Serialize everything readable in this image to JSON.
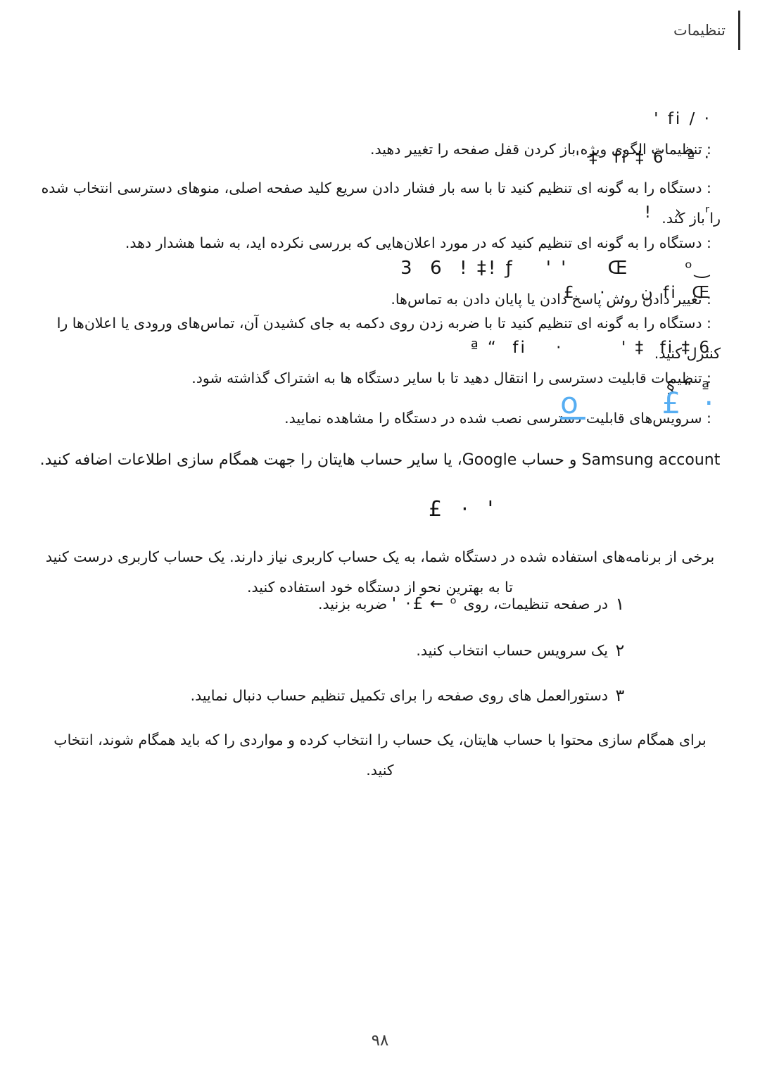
{
  "document": {
    "language": "fa",
    "direction": "rtl",
    "header_title": "تنظیمات",
    "page_number": "۹۸",
    "accent_color": "#57AEF2",
    "text_color": "#151515"
  },
  "accessibility_options": [
    {
      "id": "direct-access",
      "glyphs": "' fi / ·",
      "text": ": تنظیمات الگوی ویژه باز کردن قفل صفحه را تغییر دهید."
    },
    {
      "id": "direct-access-shortcut",
      "glyphs": "' ‡  fi ‡ 6   ª ·",
      "text": ": دستگاه را به گونه ای تنظیم کنید تا با سه بار فشار دادن سریع کلید صفحه اصلی، منوهای دسترسی انتخاب شده را باز کند."
    },
    {
      "id": "notification-reminder",
      "glyphs": "!   ›   ʳ",
      "text": ": دستگاه را به گونه ای تنظیم کنید که در مورد اعلان‌هایی که بررسی نکرده اید، به شما هشدار دهد."
    },
    {
      "id": "answering-ending-calls",
      "glyphs": "3  6  ! ‡! ƒ    ' '     Œ       ᵒ‿",
      "text": ": تغییر دادن روش پاسخ دادن یا پایان دادن به تماس‌ها."
    },
    {
      "id": "single-tap-mode",
      "glyphs": "£     ·   .   ن  fi  Œ",
      "text": ": دستگاه را به گونه ای تنظیم کنید تا با ضربه زدن روی دکمه به جای کشیدن آن، تماس‌های ورودی یا اعلان‌ها را کنترل کنید."
    },
    {
      "id": "manage-accessibility",
      "glyphs": "ª “  fi    ·        ' ‡  fi ‡ 6",
      "text": ": تنظیمات قابلیت دسترسی را انتقال دهید تا با سایر دستگاه ها به اشتراک گذاشته شود."
    },
    {
      "id": "accessibility-services",
      "glyphs": "§ “ ª",
      "text": ": سرویس‌های قابلیت دسترسی نصب شده در دستگاه را مشاهده نمایید."
    }
  ],
  "accounts_section": {
    "heading_glyphs_right": "£ ·",
    "heading_glyphs_left": "o",
    "intro": "Samsung account و حساب Google، یا سایر حساب هایتان را جهت همگام سازی اطلاعات اضافه کنید.",
    "subheading_glyphs": "£ ·     '",
    "description": "برخی از برنامه‌های استفاده شده در دستگاه شما، به یک حساب کاربری نیاز دارند. یک حساب کاربری درست کنید تا به بهترین نحو از دستگاه خود استفاده کنید.",
    "steps": [
      {
        "number": "۱",
        "text_before": "در صفحه تنظیمات، روی",
        "glyphs_a": "ᵒ",
        "arrow": "←",
        "glyphs_b": "'   ·£",
        "text_after": "ضربه بزنید."
      },
      {
        "number": "۲",
        "text_before": "یک سرویس حساب انتخاب کنید.",
        "glyphs_a": "",
        "arrow": "",
        "glyphs_b": "",
        "text_after": ""
      },
      {
        "number": "۳",
        "text_before": "دستورالعمل های روی صفحه را برای تکمیل تنظیم حساب دنبال نمایید.",
        "glyphs_a": "",
        "arrow": "",
        "glyphs_b": "",
        "text_after": ""
      }
    ],
    "closing_note": "برای همگام سازی محتوا با حساب هایتان، یک حساب را انتخاب کرده و مواردی را که باید همگام شوند، انتخاب کنید."
  }
}
